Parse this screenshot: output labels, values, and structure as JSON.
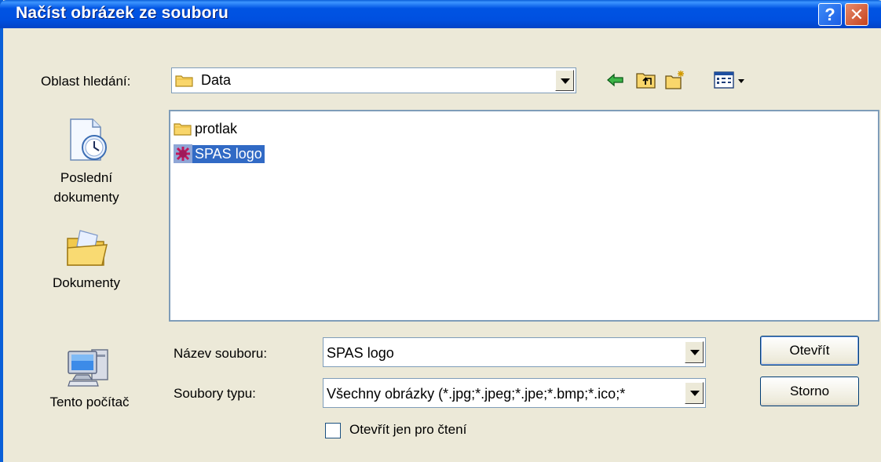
{
  "window": {
    "title": "Načíst obrázek ze souboru",
    "help_label": "?",
    "close_label": "✕"
  },
  "lookin": {
    "label": "Oblast hledání:",
    "value": "Data"
  },
  "toolbar": {
    "icons": [
      "back-icon",
      "up-folder-icon",
      "new-folder-icon",
      "views-menu-icon"
    ]
  },
  "places": [
    {
      "label": "Poslední dokumenty",
      "icon": "recent-documents-icon"
    },
    {
      "label": "Dokumenty",
      "icon": "my-documents-icon"
    },
    {
      "label": "Tento počítač",
      "icon": "my-computer-icon"
    }
  ],
  "files": [
    {
      "name": "protlak",
      "icon": "folder-icon",
      "selected": false
    },
    {
      "name": "SPAS logo",
      "icon": "image-file-icon",
      "selected": true
    }
  ],
  "filename": {
    "label": "Název souboru:",
    "value": "SPAS logo"
  },
  "filetype": {
    "label": "Soubory typu:",
    "value": "Všechny obrázky (*.jpg;*.jpeg;*.jpe;*.bmp;*.ico;*"
  },
  "readonly": {
    "label": "Otevřít jen pro čtení",
    "checked": false
  },
  "buttons": {
    "open": "Otevřít",
    "cancel": "Storno"
  },
  "colors": {
    "title_bar": "#0054E3",
    "selection": "#316AC5",
    "dialog_bg": "#ECE9D8"
  }
}
